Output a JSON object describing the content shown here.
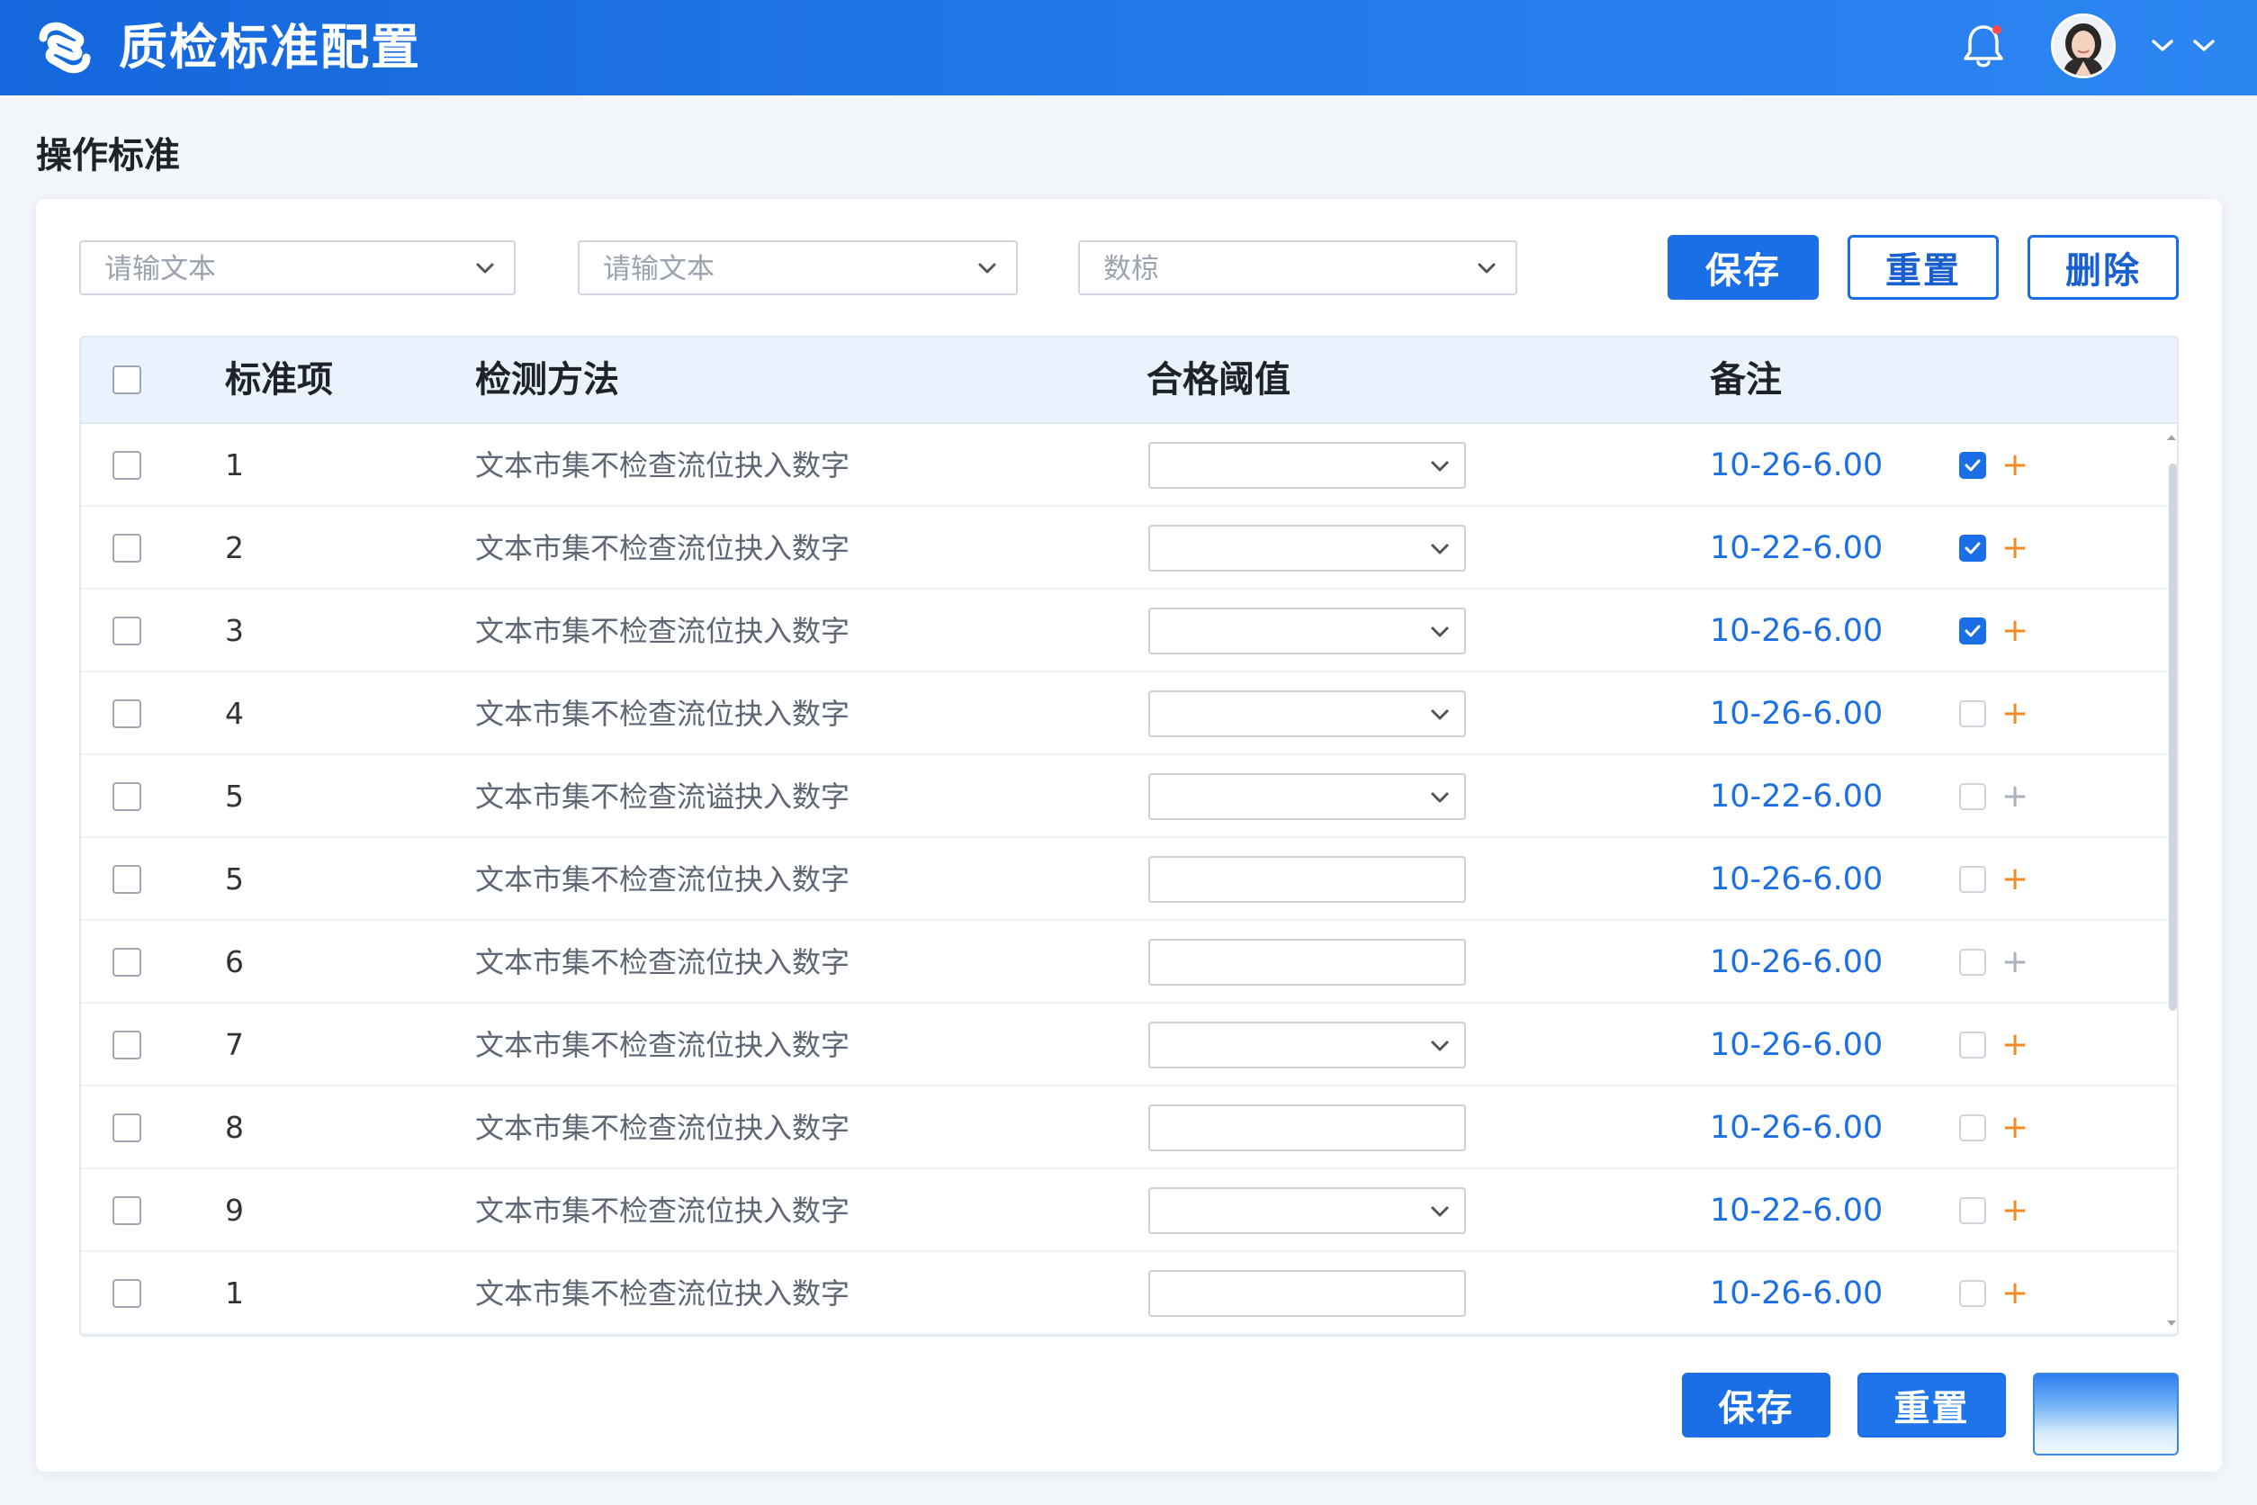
{
  "header": {
    "title": "质检标准配置",
    "accent": "#1a6fe6",
    "icons": [
      "logo-icon",
      "bell-icon",
      "avatar",
      "chevron-down-icon",
      "chevron-down-icon"
    ]
  },
  "page": {
    "title": "操作标准"
  },
  "filters": [
    {
      "placeholder": "请输文本"
    },
    {
      "placeholder": "请输文本"
    },
    {
      "placeholder": "数椋"
    }
  ],
  "toolbar": {
    "save_label": "保存",
    "reset_label": "重置",
    "delete_label": "删除"
  },
  "table": {
    "columns": [
      "标准项",
      "检测方法",
      "合格阈值",
      "备注"
    ],
    "rows": [
      {
        "item": "1",
        "method": "文本市集不检查流位抉入数字",
        "threshold_type": "select",
        "note": "10-26-6.00",
        "checked": true,
        "plus": "+",
        "plus_color": "#f08a24"
      },
      {
        "item": "2",
        "method": "文本市集不检查流位抉入数字",
        "threshold_type": "select",
        "note": "10-22-6.00",
        "checked": true,
        "plus": "+",
        "plus_color": "#f08a24"
      },
      {
        "item": "3",
        "method": "文本市集不检查流位抉入数字",
        "threshold_type": "select",
        "note": "10-26-6.00",
        "checked": true,
        "plus": "+",
        "plus_color": "#f08a24"
      },
      {
        "item": "4",
        "method": "文本市集不检查流位抉入数字",
        "threshold_type": "select",
        "note": "10-26-6.00",
        "checked": false,
        "plus": "+",
        "plus_color": "#f08a24"
      },
      {
        "item": "5",
        "method": "文本市集不检查流谥抉入数字",
        "threshold_type": "select",
        "note": "10-22-6.00",
        "checked": false,
        "plus": "+",
        "plus_color": "#aab2bd"
      },
      {
        "item": "5",
        "method": "文本市集不检查流位抉入数字",
        "threshold_type": "input",
        "note": "10-26-6.00",
        "checked": false,
        "plus": "+",
        "plus_color": "#f08a24"
      },
      {
        "item": "6",
        "method": "文本市集不检查流位抉入数字",
        "threshold_type": "input",
        "note": "10-26-6.00",
        "checked": false,
        "plus": "+",
        "plus_color": "#aab2bd"
      },
      {
        "item": "7",
        "method": "文本市集不检查流位抉入数字",
        "threshold_type": "select",
        "note": "10-26-6.00",
        "checked": false,
        "plus": "+",
        "plus_color": "#f08a24"
      },
      {
        "item": "8",
        "method": "文本市集不检查流位抉入数字",
        "threshold_type": "input",
        "note": "10-26-6.00",
        "checked": false,
        "plus": "+",
        "plus_color": "#f08a24"
      },
      {
        "item": "9",
        "method": "文本市集不检查流位抉入数字",
        "threshold_type": "select",
        "note": "10-22-6.00",
        "checked": false,
        "plus": "+",
        "plus_color": "#f08a24"
      },
      {
        "item": "1",
        "method": "文本市集不检查流位抉入数字",
        "threshold_type": "input",
        "note": "10-26-6.00",
        "checked": false,
        "plus": "+",
        "plus_color": "#f08a24"
      }
    ]
  },
  "footer": {
    "save_label": "保存",
    "reset_label": "重置",
    "third_label": ""
  }
}
